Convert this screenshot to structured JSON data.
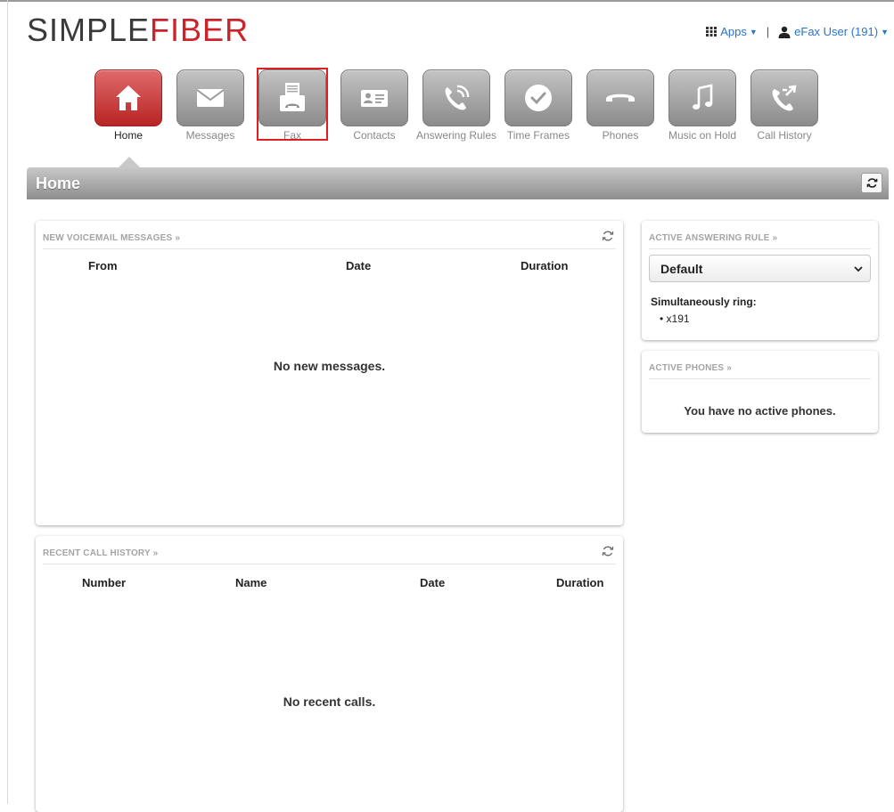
{
  "logo": {
    "part1": "SIMPLE",
    "part2": "FIBER"
  },
  "topbar": {
    "apps_label": "Apps",
    "separator": "|",
    "user_label": "eFax User (191)"
  },
  "nav": {
    "items": [
      {
        "label": "Home",
        "icon": "home-icon",
        "active": true
      },
      {
        "label": "Messages",
        "icon": "envelope-icon"
      },
      {
        "label": "Fax",
        "icon": "fax-icon"
      },
      {
        "label": "Contacts",
        "icon": "contact-card-icon"
      },
      {
        "label": "Answering Rules",
        "icon": "phone-wave-icon"
      },
      {
        "label": "Time Frames",
        "icon": "clock-icon"
      },
      {
        "label": "Phones",
        "icon": "phone-handset-icon"
      },
      {
        "label": "Music on Hold",
        "icon": "music-note-icon"
      },
      {
        "label": "Call History",
        "icon": "call-history-icon"
      }
    ]
  },
  "page": {
    "title": "Home"
  },
  "voicemail": {
    "title": "NEW VOICEMAIL MESSAGES »",
    "columns": [
      "From",
      "Date",
      "Duration"
    ],
    "empty_text": "No new messages."
  },
  "call_history": {
    "title": "RECENT CALL HISTORY »",
    "columns": [
      "Number",
      "Name",
      "Date",
      "Duration"
    ],
    "empty_text": "No recent calls."
  },
  "answering_rule": {
    "title": "ACTIVE ANSWERING RULE »",
    "selected": "Default",
    "sim_ring_label": "Simultaneously ring:",
    "sim_ring_items": [
      "x191"
    ]
  },
  "active_phones": {
    "title": "ACTIVE PHONES »",
    "empty_text": "You have no active phones."
  },
  "colors": {
    "brand_red": "#cc2229",
    "link_blue": "#2a74c9",
    "active_tile": "#c93a3a"
  }
}
